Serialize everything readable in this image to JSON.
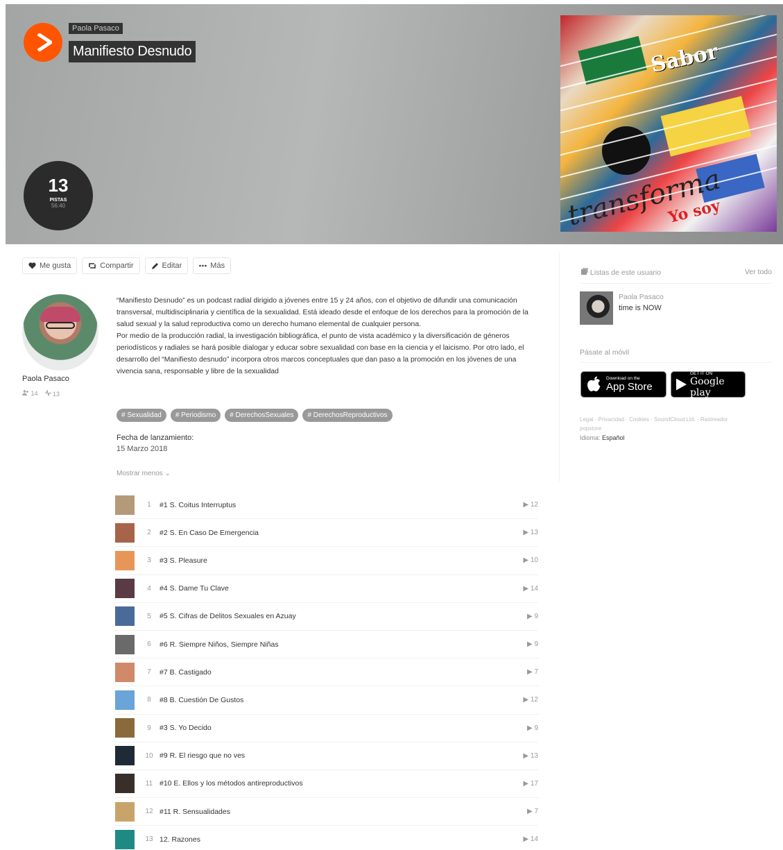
{
  "hero": {
    "username": "Paola Pasaco",
    "title": "Manifiesto Desnudo",
    "track_count": "13",
    "track_label": "PISTAS",
    "duration": "56:40",
    "cover_words": [
      "Sabor",
      "transforma",
      "Yo soy"
    ]
  },
  "actions": {
    "like": "Me gusta",
    "repost": "Compartir",
    "edit": "Editar",
    "more": "Más"
  },
  "user": {
    "name": "Paola Pasaco",
    "followers": "14",
    "tracks": "13"
  },
  "description": "“Manifiesto Desnudo” es un podcast radial dirigido a jóvenes entre 15 y 24 años, con el objetivo de difundir una comunicación transversal, multidisciplinaria y científica de la sexualidad. Está ideado desde el enfoque de los derechos para la promoción de la salud sexual y la salud reproductiva como un derecho humano elemental de cualquier persona.\nPor medio de la producción radial, la investigación bibliográfica, el punto de vista académico y la diversificación de géneros periodísticos y radiales se hará posible dialogar y educar sobre sexualidad con base en la ciencia y el laicismo. Por otro lado, el desarrollo del “Manifiesto desnudo” incorpora otros marcos conceptuales que dan paso a la promoción en los jóvenes de una vivencia sana, responsable y libre de la sexualidad",
  "tags": [
    "# Sexualidad",
    "# Periodismo",
    "# DerechosSexuales",
    "# DerechosReproductivos"
  ],
  "release": {
    "label": "Fecha de lanzamiento:",
    "date": "15 Marzo 2018"
  },
  "show_less": "Mostrar menos ⌄",
  "tracks": [
    {
      "num": "1",
      "title": "#1 S. Coitus Interruptus",
      "plays": "12",
      "color": "#b59a7a"
    },
    {
      "num": "2",
      "title": "#2 S. En Caso De Emergencia",
      "plays": "13",
      "color": "#a8644a"
    },
    {
      "num": "3",
      "title": "#3 S. Pleasure",
      "plays": "10",
      "color": "#e8955a"
    },
    {
      "num": "4",
      "title": "#4 S. Dame Tu Clave",
      "plays": "14",
      "color": "#5a3a44"
    },
    {
      "num": "5",
      "title": "#5 S. Cifras de Delitos Sexuales en Azuay",
      "plays": "9",
      "color": "#4a6a9a"
    },
    {
      "num": "6",
      "title": "#6 R. Siempre Niños, Siempre Niñas",
      "plays": "9",
      "color": "#6a6a6a"
    },
    {
      "num": "7",
      "title": "#7 B. Castigado",
      "plays": "7",
      "color": "#d08a6a"
    },
    {
      "num": "8",
      "title": "#8 B. Cuestión De Gustos",
      "plays": "12",
      "color": "#6aa4d8"
    },
    {
      "num": "9",
      "title": "#3 S. Yo Decido",
      "plays": "9",
      "color": "#8a6a3a"
    },
    {
      "num": "10",
      "title": "#9 R. El riesgo que no ves",
      "plays": "13",
      "color": "#1e2a36"
    },
    {
      "num": "11",
      "title": "#10 E. Ellos y los métodos antireproductivos",
      "plays": "17",
      "color": "#3a2e28"
    },
    {
      "num": "12",
      "title": "#11 R. Sensualidades",
      "plays": "7",
      "color": "#c9a46a"
    },
    {
      "num": "13",
      "title": "12. Razones",
      "plays": "14",
      "color": "#1f8a84"
    }
  ],
  "sidebar": {
    "playlists_heading": "Listas de este usuario",
    "view_all": "Ver todo",
    "playlist_user": "Paola Pasaco",
    "playlist_title": "time is NOW",
    "mobile_heading": "Pásate al móvil",
    "app_store_small": "Download on the",
    "app_store_big": "App Store",
    "google_small": "GET IT ON",
    "google_big": "Google play",
    "footer_links": "Legal · Privacidad · Cookies · SoundCloud Ltd. · Rastreador popstore",
    "lang_key": "Idioma:",
    "lang_value": "Español"
  }
}
